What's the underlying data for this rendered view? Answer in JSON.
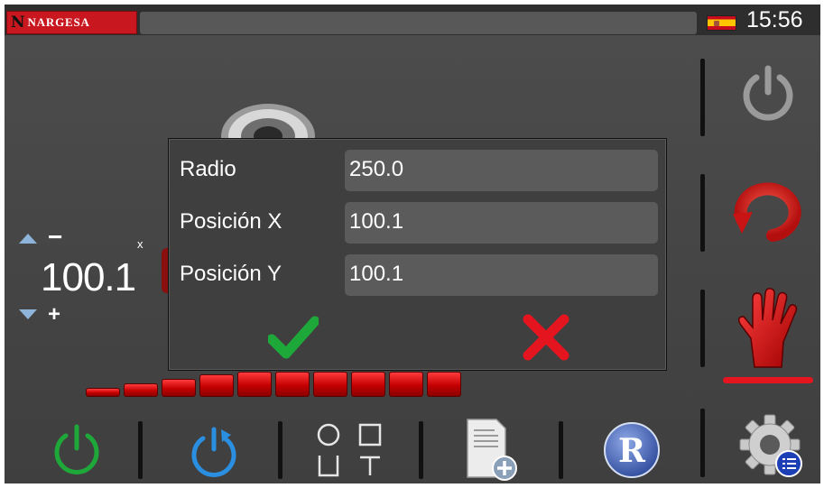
{
  "header": {
    "brand_initial": "N",
    "brand_name": "NARGESA",
    "language_flag_icon": "spain-flag-icon",
    "time": "15:56"
  },
  "position_panel": {
    "minus_label": "−",
    "plus_label": "+",
    "axis_label": "x",
    "value": "100.1"
  },
  "dialog": {
    "fields": [
      {
        "label": "Radio",
        "value": "250.0"
      },
      {
        "label": "Posición X",
        "value": "100.1"
      },
      {
        "label": "Posición Y",
        "value": "100.1"
      }
    ],
    "confirm_icon": "checkmark-icon",
    "cancel_icon": "x-icon"
  },
  "sidebar": {
    "items": [
      {
        "icon": "power-icon"
      },
      {
        "icon": "cycle-icon"
      },
      {
        "icon": "hand-stop-icon",
        "active": true
      }
    ],
    "settings_icon": "gear-icon"
  },
  "toolbar": {
    "items": [
      {
        "icon": "power-on-icon"
      },
      {
        "icon": "reset-icon"
      },
      {
        "icon": "shapes-icon"
      },
      {
        "icon": "new-document-icon"
      },
      {
        "icon": "r-logo-icon",
        "text": "R"
      }
    ]
  },
  "colors": {
    "accent_red": "#e51520",
    "success_green": "#1fa83a",
    "reset_blue": "#2a8fe0",
    "background": "#484848"
  },
  "level_bars": {
    "count": 10,
    "filled": 10
  }
}
